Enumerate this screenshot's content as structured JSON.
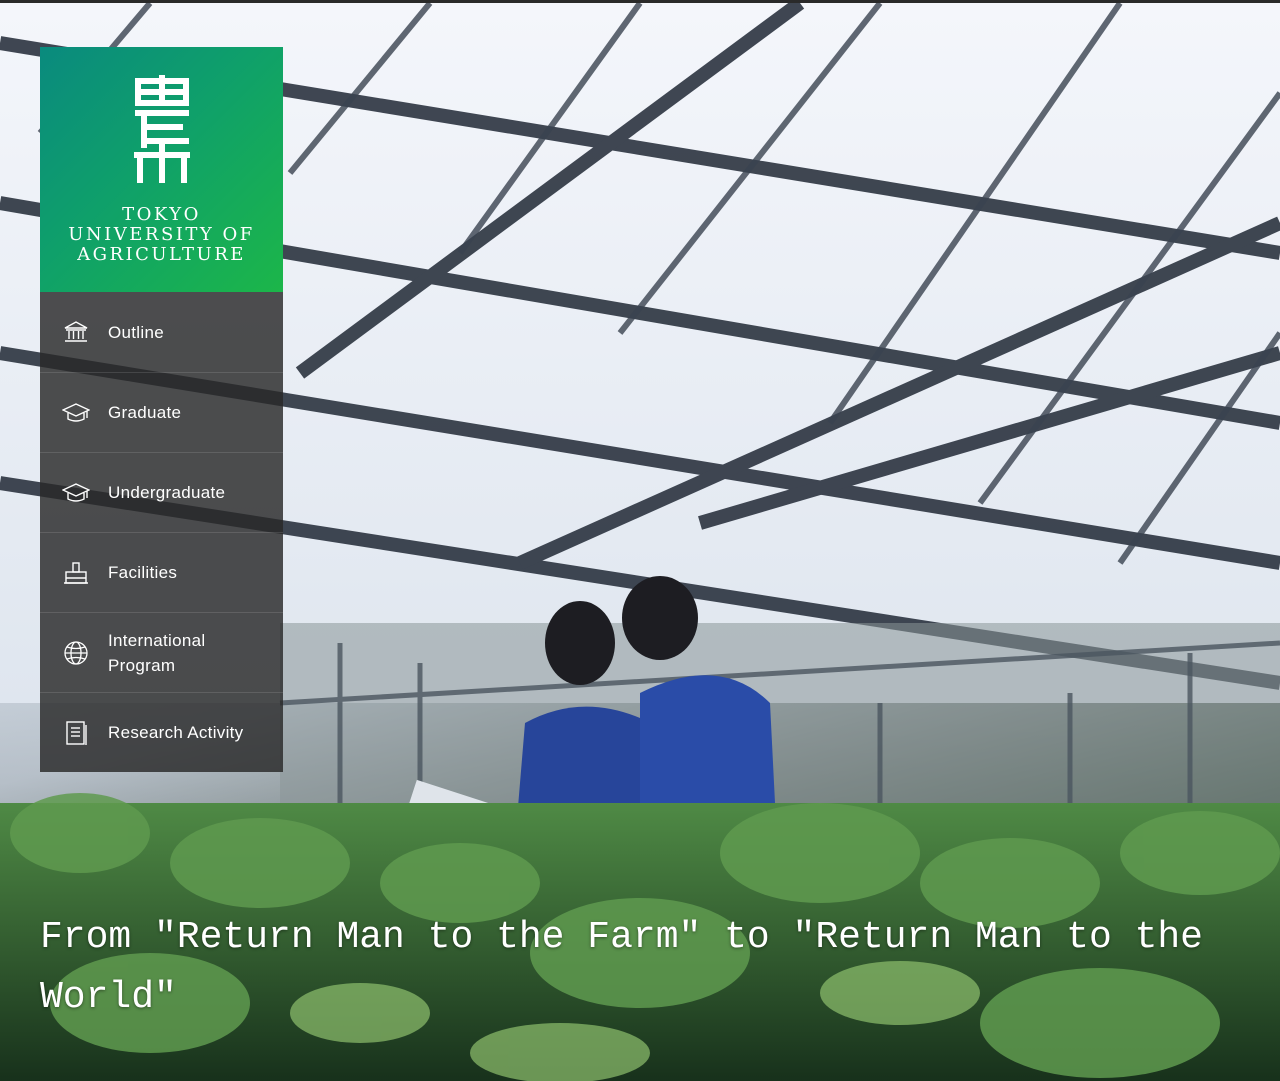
{
  "logo": {
    "mark_icon": "tokyo-nodai-kanji-logo",
    "lines": [
      "TOKYO",
      "UNIVERSITY OF",
      "AGRICULTURE"
    ],
    "gradient": [
      "#0a8a7e",
      "#1cb649"
    ]
  },
  "nav": {
    "items": [
      {
        "label": "Outline",
        "icon": "building-icon"
      },
      {
        "label": "Graduate",
        "icon": "graduation-cap-icon"
      },
      {
        "label": "Undergraduate",
        "icon": "graduation-cap-icon"
      },
      {
        "label": "Facilities",
        "icon": "facility-icon"
      },
      {
        "label": "International\nProgram",
        "icon": "globe-icon"
      },
      {
        "label": "Research Activity",
        "icon": "document-icon"
      }
    ]
  },
  "hero": {
    "tagline": "From ″Return Man to the Farm″ to ″Return Man to the World″"
  }
}
